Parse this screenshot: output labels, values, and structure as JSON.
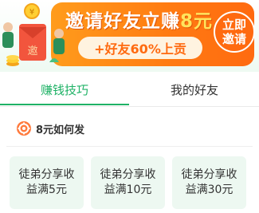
{
  "banner": {
    "title_prefix": "邀请好友立赚",
    "title_amount": "8元",
    "bonus_text": "+好友60%上贡",
    "invite_button_line1": "立即",
    "invite_button_line2": "邀请",
    "illustration_text": "邀",
    "coin_symbol": "¥"
  },
  "tabs": [
    {
      "label": "赚钱技巧",
      "active": true
    },
    {
      "label": "我的好友",
      "active": false
    }
  ],
  "section": {
    "title": "8元如何发",
    "icon": "gear-icon"
  },
  "cards": [
    {
      "line1": "徒弟分享收",
      "line2": "益满5元"
    },
    {
      "line1": "徒弟分享收",
      "line2": "益满10元"
    },
    {
      "line1": "徒弟分享收",
      "line2": "益满30元"
    }
  ],
  "colors": {
    "accent_green": "#1fb266",
    "banner_orange": "#ff7a12",
    "amount_yellow": "#ffe45c",
    "card_bg": "#edf8f1"
  }
}
